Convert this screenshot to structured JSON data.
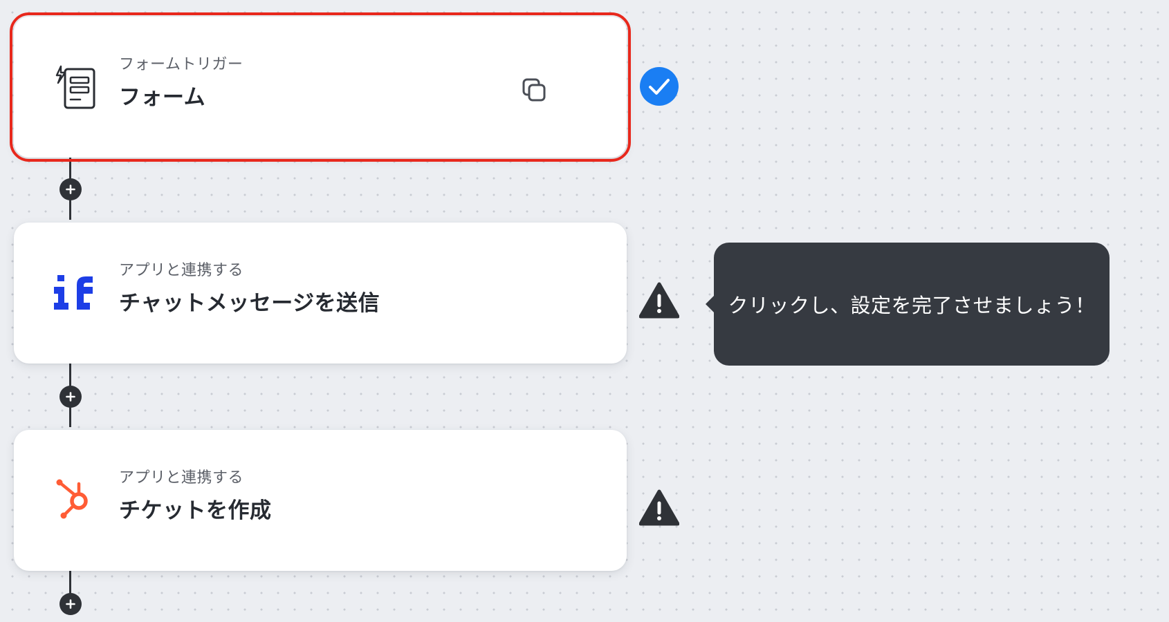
{
  "flow": {
    "steps": [
      {
        "kind": "フォームトリガー",
        "title": "フォーム",
        "icon": "form-trigger-icon",
        "status": "complete",
        "selected": true
      },
      {
        "kind": "アプリと連携する",
        "title": "チャットメッセージを送信",
        "icon": "if-app-logo",
        "status": "warning"
      },
      {
        "kind": "アプリと連携する",
        "title": "チケットを作成",
        "icon": "hubspot-logo",
        "status": "warning"
      }
    ],
    "tooltip": {
      "text": "クリックし、設定を完了させましょう！"
    }
  },
  "colors": {
    "selection_outline": "#e8281c",
    "complete_badge": "#1a7ef3",
    "warning_icon": "#2f3237",
    "if_logo": "#1d3ee6",
    "hubspot_logo": "#ff5c35",
    "tooltip_bg": "#363a41",
    "connector": "#2f3237"
  }
}
